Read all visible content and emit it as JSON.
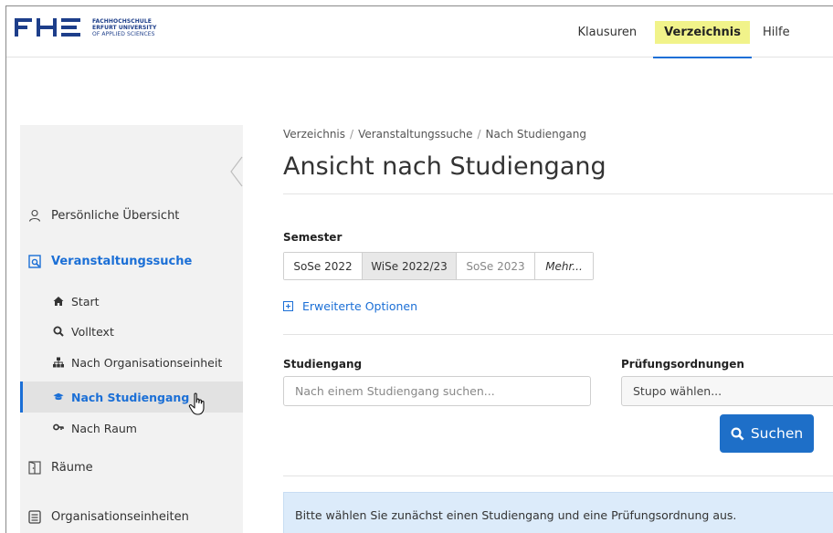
{
  "header": {
    "logo": {
      "mark": "FHE",
      "lines": [
        "FACHHOCHSCHULE",
        "ERFURT UNIVERSITY",
        "OF APPLIED SCIENCES"
      ]
    },
    "nav": [
      {
        "label": "Klausuren"
      },
      {
        "label": "Verzeichnis",
        "active": true
      },
      {
        "label": "Hilfe"
      }
    ]
  },
  "sidebar": {
    "items": [
      {
        "label": "Persönliche Übersicht",
        "icon": "user-icon"
      },
      {
        "label": "Veranstaltungssuche",
        "icon": "search-doc-icon",
        "section": true
      },
      {
        "label": "Start",
        "icon": "home-icon"
      },
      {
        "label": "Volltext",
        "icon": "search-icon"
      },
      {
        "label": "Nach Organisationseinheit",
        "icon": "org-icon"
      },
      {
        "label": "Nach Studiengang",
        "icon": "graduation-cap-icon",
        "selected": true
      },
      {
        "label": "Nach Raum",
        "icon": "key-icon"
      },
      {
        "label": "Räume",
        "icon": "door-icon"
      },
      {
        "label": "Organisationseinheiten",
        "icon": "building-icon"
      }
    ]
  },
  "main": {
    "breadcrumb": [
      "Verzeichnis",
      "Veranstaltungssuche",
      "Nach Studiengang"
    ],
    "title": "Ansicht nach Studiengang",
    "semester": {
      "label": "Semester",
      "options": [
        "SoSe 2022",
        "WiSe 2022/23",
        "SoSe 2023",
        "Mehr..."
      ],
      "selected": "WiSe 2022/23"
    },
    "advanced": "Erweiterte Optionen",
    "studiengang": {
      "label": "Studiengang",
      "placeholder": "Nach einem Studiengang suchen..."
    },
    "pruefungsordnung": {
      "label": "Prüfungsordnungen",
      "value": "Stupo wählen..."
    },
    "search_button": "Suchen",
    "info": "Bitte wählen Sie zunächst einen Studiengang und eine Prüfungsordnung aus."
  },
  "colors": {
    "accent": "#1b6fd6",
    "highlight": "#f1f38a",
    "button": "#1e6fc8",
    "info_bg": "#dcebfa",
    "logo_blue": "#1d3e8a"
  }
}
